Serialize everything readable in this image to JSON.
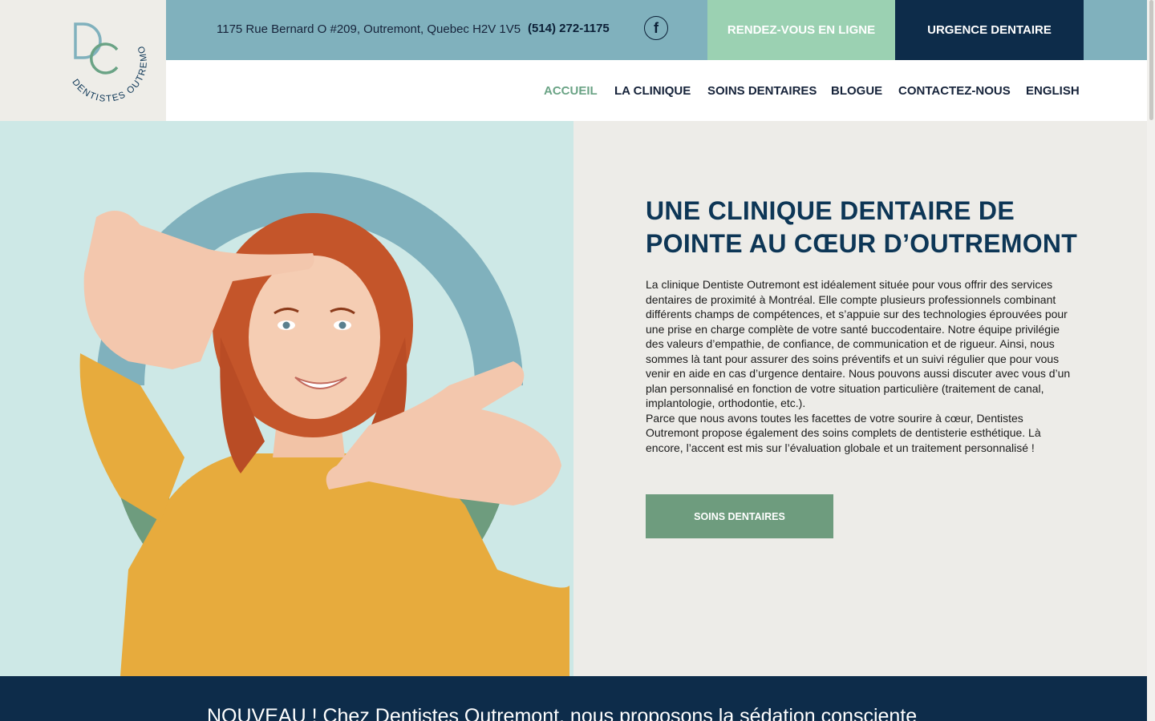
{
  "logo": {
    "monogram": "DO",
    "arc_text": "DENTISTES OUTREMONT"
  },
  "topbar": {
    "address": "1175 Rue Bernard O #209, Outremont, Quebec H2V 1V5",
    "phone": "(514) 272-1175",
    "facebook_icon": "f",
    "rdv_label": "RENDEZ-VOUS EN LIGNE",
    "urgence_label": "URGENCE DENTAIRE"
  },
  "nav": {
    "items": [
      {
        "label": "ACCUEIL",
        "active": true
      },
      {
        "label": "LA CLINIQUE"
      },
      {
        "label": "SOINS DENTAIRES"
      },
      {
        "label": "BLOGUE"
      },
      {
        "label": "CONTACTEZ-NOUS"
      },
      {
        "label": "ENGLISH"
      }
    ]
  },
  "hero": {
    "title": "UNE CLINIQUE DENTAIRE DE POINTE AU CŒUR D’OUTREMONT",
    "paragraph_1": "La clinique Dentiste Outremont est idéalement située pour vous offrir des services dentaires de proximité à Montréal. Elle compte plusieurs professionnels combinant différents champs de compétences, et s’appuie sur des technologies éprouvées pour une prise en charge complète de votre santé buccodentaire. Notre équipe privilégie des valeurs d’empathie, de confiance, de communication et de rigueur. Ainsi, nous sommes là tant pour assurer des soins préventifs et un suivi régulier que pour vous venir en aide en cas d’urgence dentaire. Nous pouvons aussi discuter avec vous d’un plan personnalisé en fonction de votre situation particulière (traitement de canal, implantologie, orthodontie, etc.).",
    "paragraph_2": "Parce que nous avons toutes les facettes de votre sourire à cœur, Dentistes Outremont propose également des soins complets de dentisterie esthétique. Là encore, l’accent est mis sur l’évaluation globale et un traitement personnalisé !",
    "button_label": "SOINS DENTAIRES"
  },
  "banner": {
    "text": "NOUVEAU ! Chez Dentistes Outremont, nous proposons la sédation consciente"
  },
  "colors": {
    "teal": "#80b1bd",
    "mint": "#9bd1b2",
    "navy": "#0d2c4a",
    "green": "#6e9c7e",
    "light_teal": "#cde8e6",
    "beige": "#edece8"
  }
}
